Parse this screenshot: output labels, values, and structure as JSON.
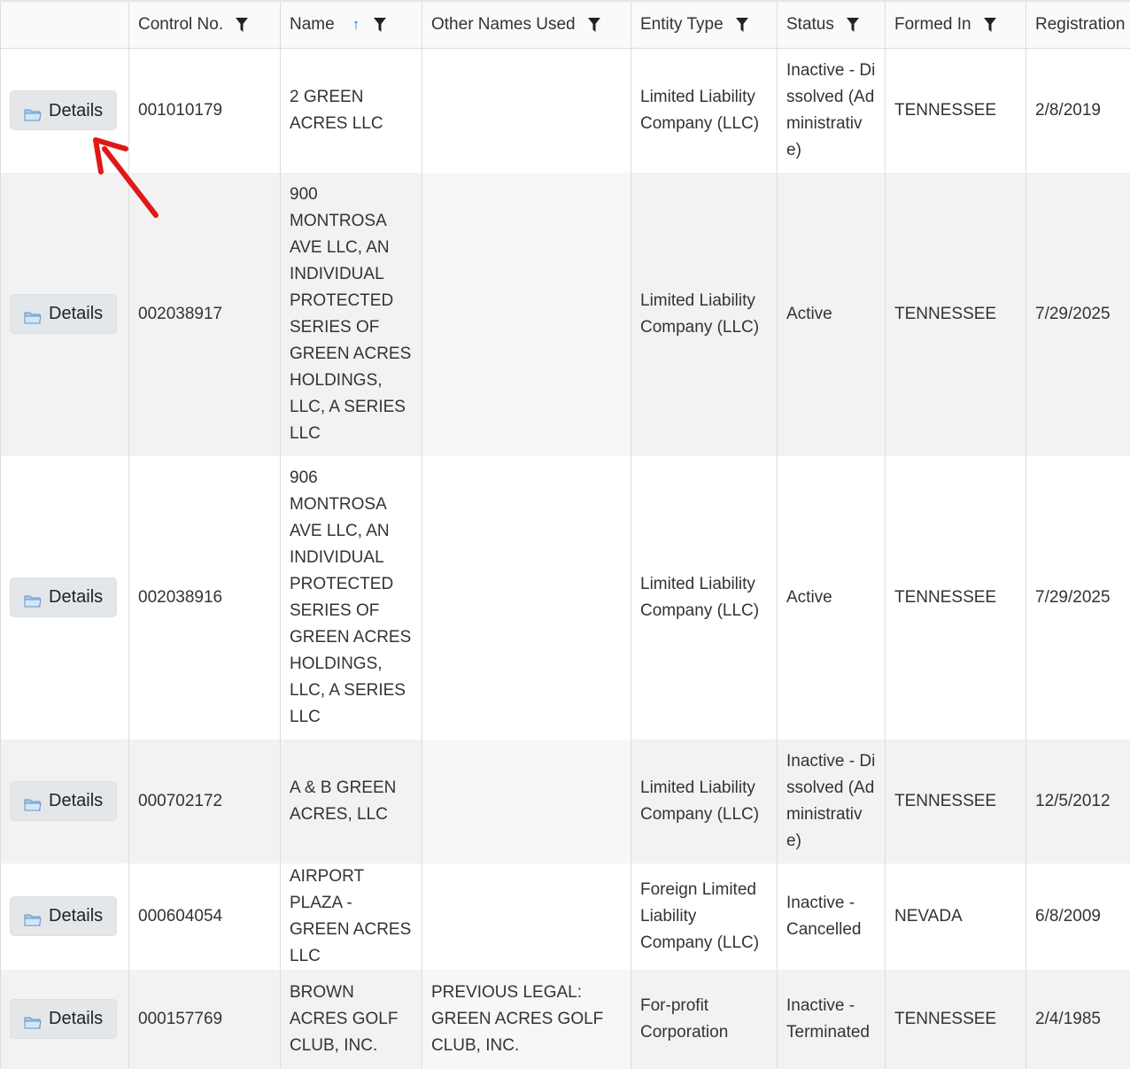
{
  "table": {
    "columns": [
      {
        "key": "details",
        "label": ""
      },
      {
        "key": "control_no",
        "label": "Control No."
      },
      {
        "key": "name",
        "label": "Name"
      },
      {
        "key": "other_names",
        "label": "Other Names Used"
      },
      {
        "key": "entity_type",
        "label": "Entity Type"
      },
      {
        "key": "status",
        "label": "Status"
      },
      {
        "key": "formed_in",
        "label": "Formed In"
      },
      {
        "key": "registration",
        "label": "Registration"
      }
    ],
    "details_label": "Details",
    "rows": [
      {
        "control_no": "001010179",
        "name": "2 GREEN ACRES LLC",
        "other_names": "",
        "entity_type": "Limited Liability Company (LLC)",
        "status": "Inactive - Dissolved (Administrative)",
        "formed_in": "TENNESSEE",
        "registration": "2/8/2019"
      },
      {
        "control_no": "002038917",
        "name": "900 MONTROSA AVE LLC, AN INDIVIDUAL PROTECTED SERIES OF GREEN ACRES HOLDINGS, LLC, A SERIES LLC",
        "other_names": "",
        "entity_type": "Limited Liability Company (LLC)",
        "status": "Active",
        "formed_in": "TENNESSEE",
        "registration": "7/29/2025"
      },
      {
        "control_no": "002038916",
        "name": "906 MONTROSA AVE LLC, AN INDIVIDUAL PROTECTED SERIES OF GREEN ACRES HOLDINGS, LLC, A SERIES LLC",
        "other_names": "",
        "entity_type": "Limited Liability Company (LLC)",
        "status": "Active",
        "formed_in": "TENNESSEE",
        "registration": "7/29/2025"
      },
      {
        "control_no": "000702172",
        "name": "A & B GREEN ACRES, LLC",
        "other_names": "",
        "entity_type": "Limited Liability Company (LLC)",
        "status": "Inactive - Dissolved (Administrative)",
        "formed_in": "TENNESSEE",
        "registration": "12/5/2012"
      },
      {
        "control_no": "000604054",
        "name": "AIRPORT PLAZA - GREEN ACRES LLC",
        "other_names": "",
        "entity_type": "Foreign Limited Liability Company (LLC)",
        "status": "Inactive - Cancelled",
        "formed_in": "NEVADA",
        "registration": "6/8/2009"
      },
      {
        "control_no": "000157769",
        "name": "BROWN ACRES GOLF CLUB, INC.",
        "other_names": "PREVIOUS LEGAL: GREEN ACRES GOLF CLUB, INC.",
        "entity_type": "For-profit Corporation",
        "status": "Inactive - Terminated",
        "formed_in": "TENNESSEE",
        "registration": "2/4/1985"
      }
    ]
  },
  "sort_indicator": "↑",
  "annotation": {
    "arrow_color": "#e01818"
  }
}
